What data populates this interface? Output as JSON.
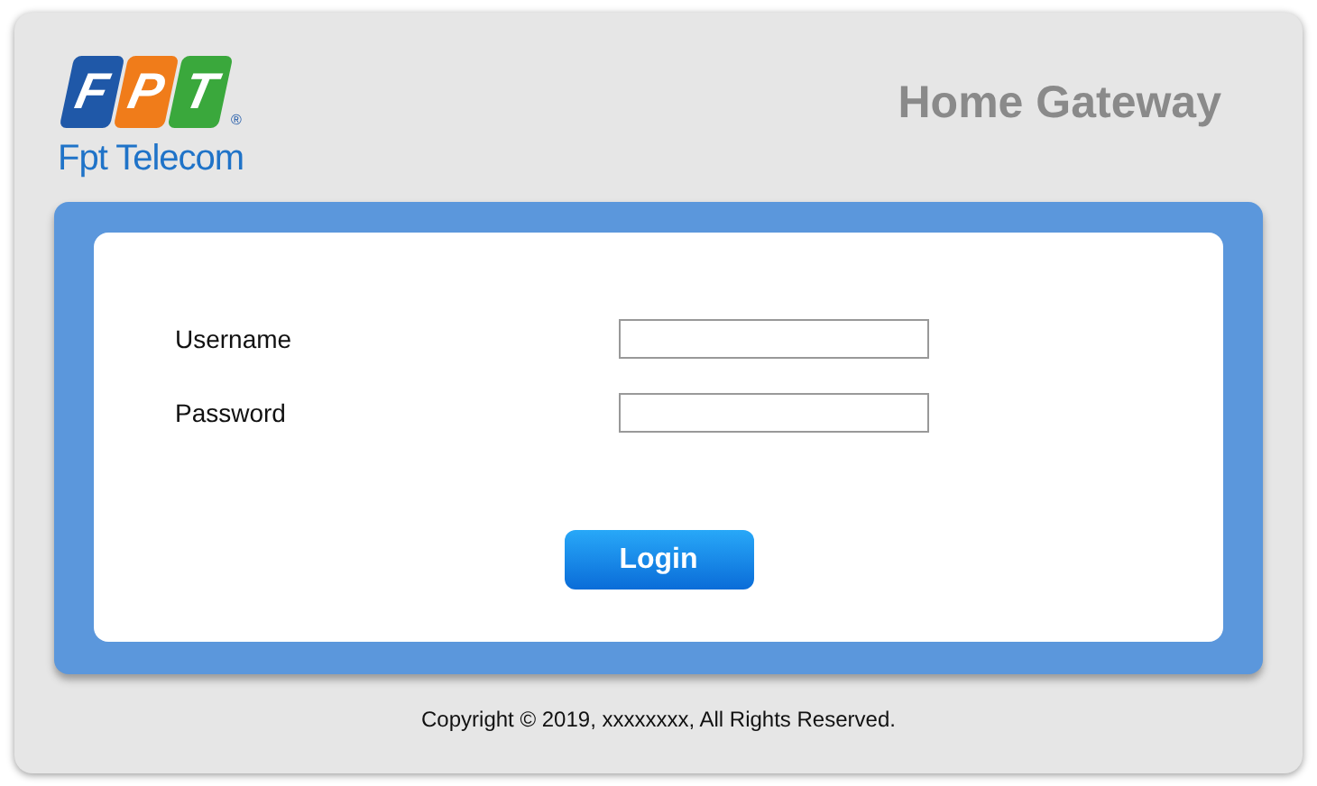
{
  "logo": {
    "letters": [
      "F",
      "P",
      "T"
    ],
    "registered": "®",
    "company": "Fpt Telecom"
  },
  "header": {
    "title": "Home Gateway"
  },
  "form": {
    "fields": [
      {
        "label": "Username"
      },
      {
        "label": "Password"
      }
    ],
    "button": "Login"
  },
  "footer": {
    "copyright": "Copyright © 2019, xxxxxxxx, All Rights Reserved."
  }
}
